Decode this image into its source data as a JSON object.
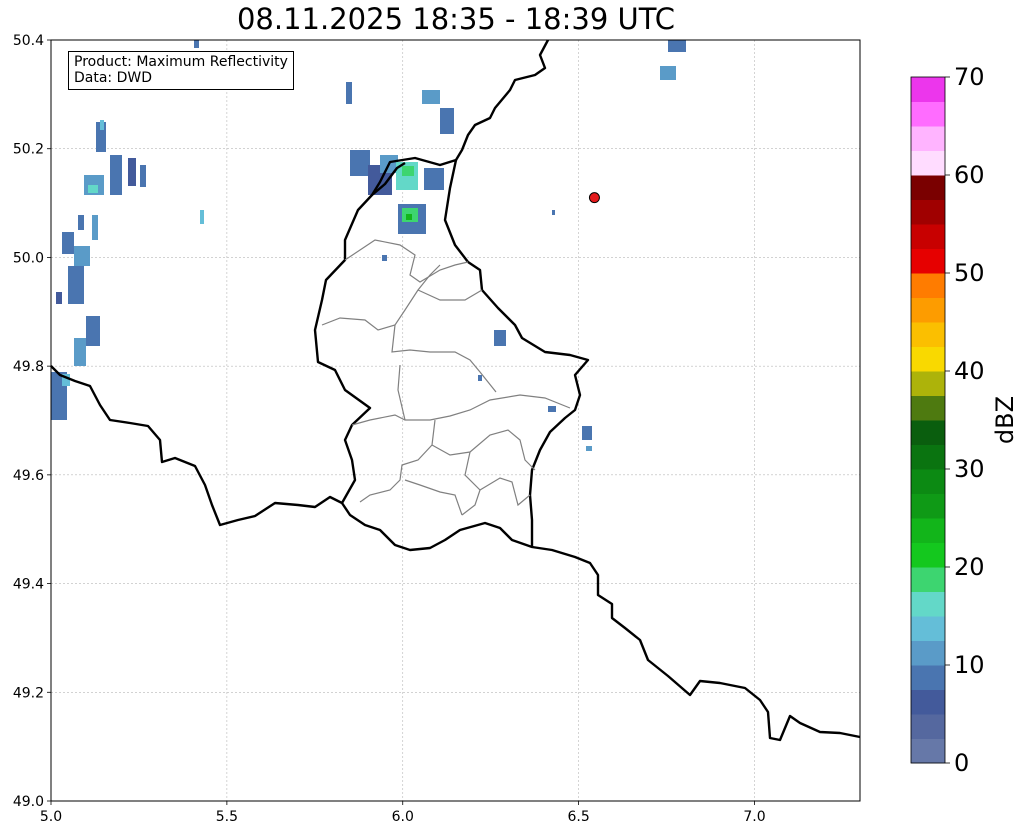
{
  "title": "08.11.2025 18:35 - 18:39 UTC",
  "info_box": {
    "product_line": "Product: Maximum Reflectivity",
    "data_line": "Data: DWD"
  },
  "map": {
    "lon_range": [
      5.0,
      7.3
    ],
    "lat_range": [
      49.0,
      50.4
    ],
    "x_ticks": [
      "5.0",
      "5.5",
      "6.0",
      "6.5",
      "7.0"
    ],
    "y_ticks": [
      "49.0",
      "49.2",
      "49.4",
      "49.6",
      "49.8",
      "50.0",
      "50.2",
      "50.4"
    ],
    "grid": true,
    "marker": {
      "lon": 6.545,
      "lat": 50.11,
      "color": "#e41a1c"
    }
  },
  "colorbar": {
    "label": "dBZ",
    "ticks": [
      "0",
      "10",
      "20",
      "30",
      "40",
      "50",
      "60",
      "70"
    ],
    "range": [
      0,
      70
    ],
    "step": 2.5,
    "colors": [
      "#6678a8",
      "#55689f",
      "#435a9b",
      "#4a75b0",
      "#5a9bc8",
      "#64bed8",
      "#63d8c8",
      "#3dd570",
      "#14c81e",
      "#12b51a",
      "#0f9a16",
      "#0c8a13",
      "#0a7410",
      "#0a5e0e",
      "#4e7a10",
      "#adb30a",
      "#f9d900",
      "#fbbf00",
      "#fd9c00",
      "#ff7c00",
      "#e60000",
      "#c80000",
      "#a00000",
      "#7a0000",
      "#ffdcff",
      "#ffb4ff",
      "#ff6cff",
      "#ec36ec"
    ]
  }
}
